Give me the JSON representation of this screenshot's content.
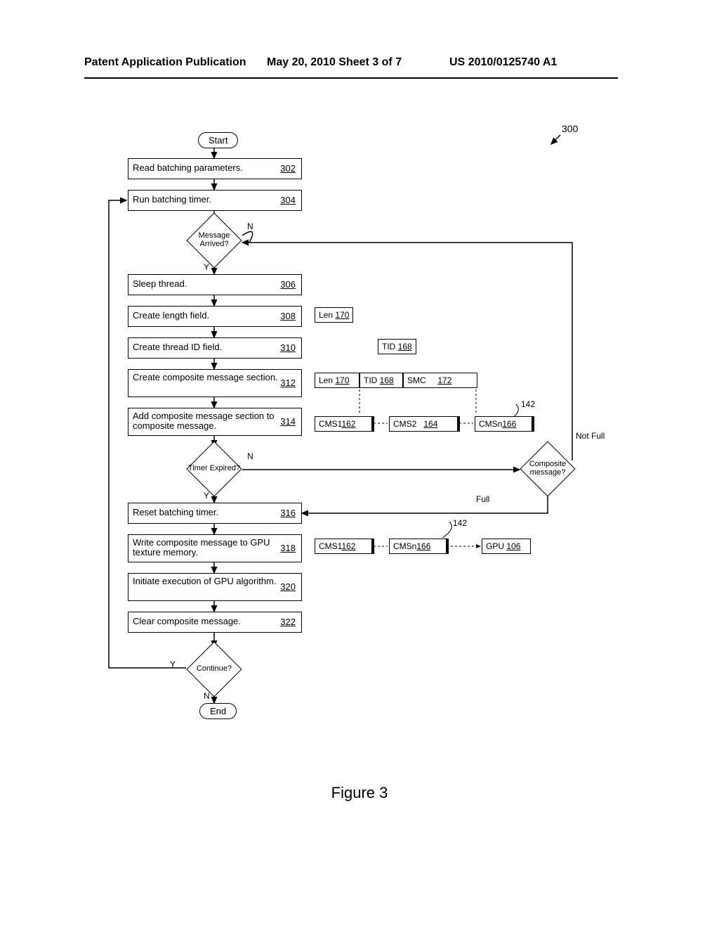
{
  "header": {
    "left": "Patent Application Publication",
    "center": "May 20, 2010   Sheet 3 of 7",
    "right": "US 2010/0125740 A1"
  },
  "diagram": {
    "ref_num": "300",
    "start": "Start",
    "end": "End",
    "steps": {
      "s302": {
        "text": "Read batching parameters.",
        "num": "302"
      },
      "s304": {
        "text": "Run batching timer.",
        "num": "304"
      },
      "s306": {
        "text": "Sleep thread.",
        "num": "306"
      },
      "s308": {
        "text": "Create length field.",
        "num": "308"
      },
      "s310": {
        "text": "Create thread ID field.",
        "num": "310"
      },
      "s312": {
        "text": "Create composite message section.",
        "num": "312"
      },
      "s314": {
        "text": "Add composite message section to composite message.",
        "num": "314"
      },
      "s316": {
        "text": "Reset batching timer.",
        "num": "316"
      },
      "s318": {
        "text": "Write composite message to GPU texture memory.",
        "num": "318"
      },
      "s320": {
        "text": "Initiate execution of GPU algorithm.",
        "num": "320"
      },
      "s322": {
        "text": "Clear composite message.",
        "num": "322"
      }
    },
    "decisions": {
      "msg_arrived": "Message Arrived?",
      "timer_expired": "Timer Expired?",
      "composite": "Composite message?",
      "continue": "Continue?"
    },
    "labels": {
      "Y": "Y",
      "N": "N",
      "Full": "Full",
      "NotFull": "Not Full"
    },
    "data_boxes": {
      "len_170": "Len  170",
      "tid_168": "TID  168",
      "smc_172": "SMC        172",
      "cms1_162": "CMS1 162",
      "cms2_164": "CMS2    164",
      "cmsn_166": "CMSn 166",
      "gpu_106": "GPU 106",
      "ref_142": "142"
    }
  },
  "caption": "Figure 3"
}
